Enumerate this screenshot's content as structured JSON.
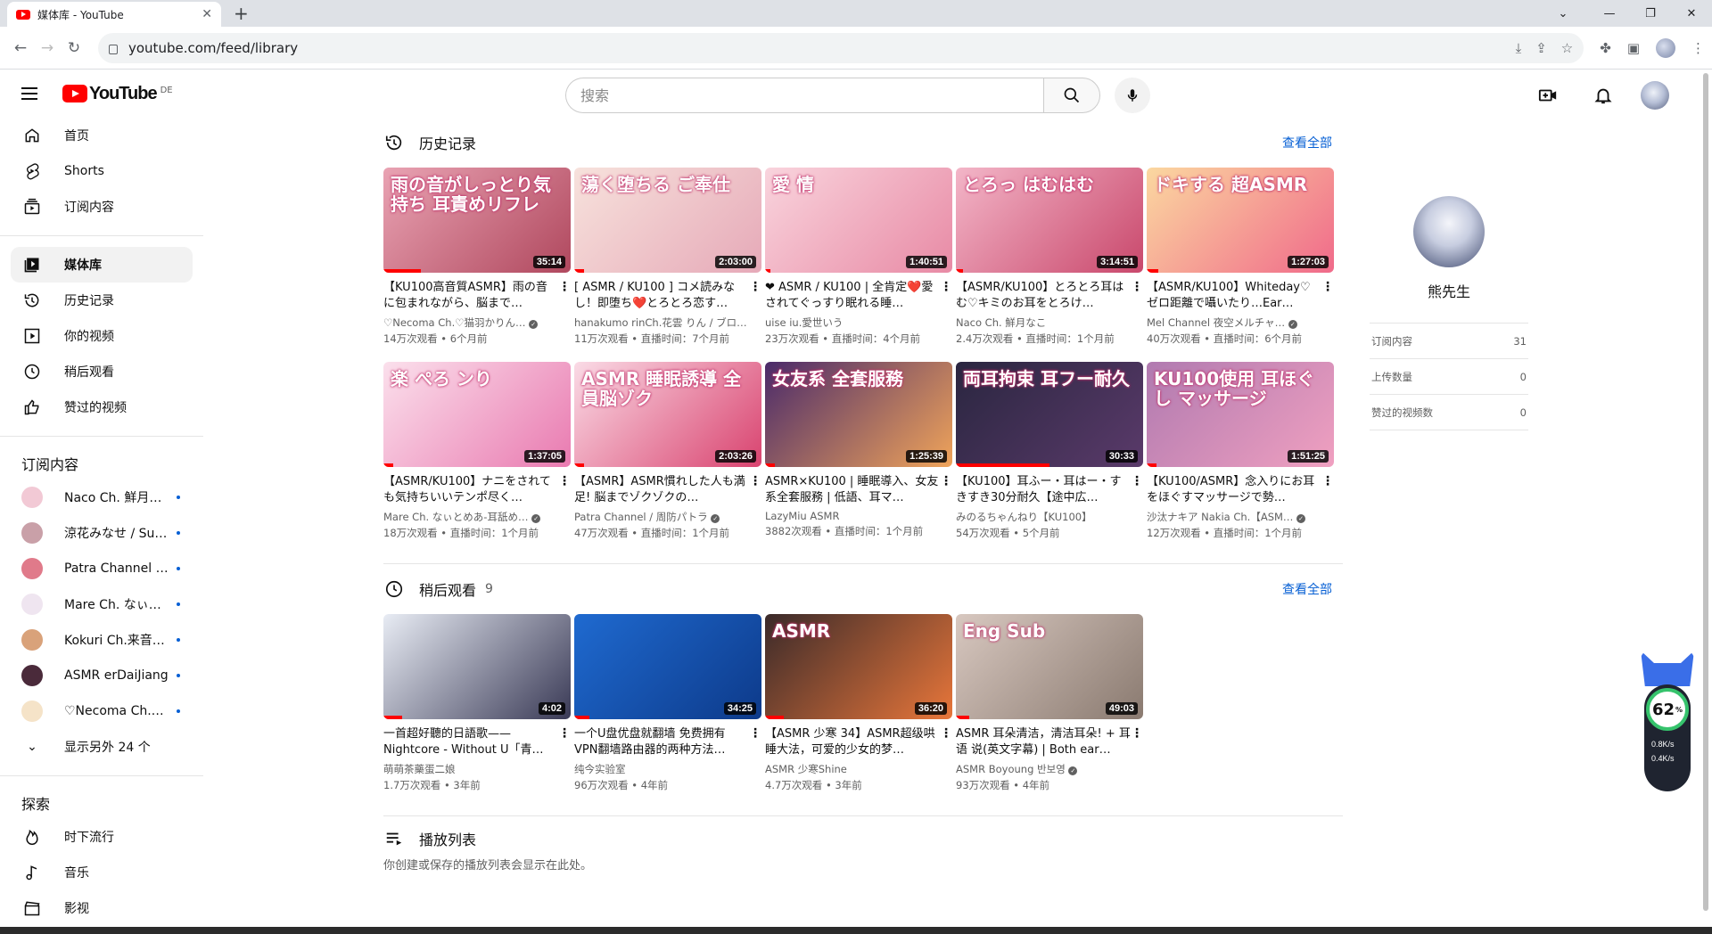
{
  "browser": {
    "tab_title": "媒体库 - YouTube",
    "tab_close": "✕",
    "new_tab": "+",
    "url": "youtube.com/feed/library"
  },
  "header": {
    "logo_text": "YouTube",
    "country_code": "DE",
    "search_placeholder": "搜索"
  },
  "sidebar": {
    "main_items": [
      {
        "label": "首页",
        "icon": "home-icon"
      },
      {
        "label": "Shorts",
        "icon": "shorts-icon"
      },
      {
        "label": "订阅内容",
        "icon": "subscriptions-icon"
      }
    ],
    "library_items": [
      {
        "label": "媒体库",
        "icon": "library-icon",
        "active": true
      },
      {
        "label": "历史记录",
        "icon": "history-icon"
      },
      {
        "label": "你的视频",
        "icon": "your-videos-icon"
      },
      {
        "label": "稍后观看",
        "icon": "watch-later-icon"
      },
      {
        "label": "赞过的视频",
        "icon": "liked-icon"
      }
    ],
    "subscriptions_heading": "订阅内容",
    "subscriptions": [
      {
        "name": "Naco Ch. 鮮月な…",
        "color": "#f2c9d5"
      },
      {
        "name": "涼花みなせ / Suz…",
        "color": "#c9a0a8"
      },
      {
        "name": "Patra Channel / …",
        "color": "#e07a8a"
      },
      {
        "name": "Mare Ch. なぃとめ…",
        "color": "#efe5f0"
      },
      {
        "name": "Kokuri Ch.来音こ…",
        "color": "#d9a27a"
      },
      {
        "name": "ASMR erDaiJiang",
        "color": "#4a2a3a"
      },
      {
        "name": "♡Necoma Ch.♡…",
        "color": "#f5e3c8"
      }
    ],
    "show_more": "显示另外 24 个",
    "explore_heading": "探索",
    "explore_items": [
      {
        "label": "时下流行",
        "icon": "trending-icon"
      },
      {
        "label": "音乐",
        "icon": "music-icon"
      },
      {
        "label": "影视",
        "icon": "movies-icon"
      }
    ]
  },
  "history": {
    "title": "历史记录",
    "see_all": "查看全部",
    "videos": [
      {
        "thumb": "雨の音がしっとり気持ち 耳責めリフレ",
        "title": "【KU100高音質ASMR】雨の音に包まれながら、脳まで…",
        "channel": "♡Necoma Ch.♡猫羽かりん…",
        "verified": true,
        "meta": "14万次观看 • 6个月前",
        "duration": "35:14",
        "progress": 0.2,
        "c1": "#e9a3b3",
        "c2": "#b0485e"
      },
      {
        "title": "[ ASMR / KU100 ] コメ読みなし！即堕ち❤️とろとろ恋す…",
        "thumb": "蕩く堕ちる ご奉仕",
        "channel": "hanakumo rinCh.花雲 りん / ブロ…",
        "verified": false,
        "meta": "11万次观看 • 直播时间：7个月前",
        "duration": "2:03:00",
        "progress": 0.05,
        "c1": "#f7e2dc",
        "c2": "#e6a9b8"
      },
      {
        "title": "❤ ASMR / KU100 | 全肯定❤️愛されてぐっすり眠れる睡…",
        "thumb": "愛 情",
        "channel": "uise iu.愛世いう",
        "verified": false,
        "meta": "23万次观看 • 直播时间：4个月前",
        "duration": "1:40:51",
        "progress": 0.03,
        "c1": "#f9d4dd",
        "c2": "#e88aa5"
      },
      {
        "title": "【ASMR/KU100】とろとろ耳はむ♡キミのお耳をとろけ…",
        "thumb": "とろっ はむはむ",
        "channel": "Naco Ch. 鮮月なこ",
        "verified": false,
        "meta": "2.4万次观看 • 直播时间：1个月前",
        "duration": "3:14:51",
        "progress": 0.04,
        "c1": "#f3b6c8",
        "c2": "#c9486c"
      },
      {
        "title": "【ASMR/KU100】Whiteday♡ゼロ距離で囁いたり…Ear…",
        "thumb": "ドキする 超ASMR",
        "channel": "Mel Channel 夜空メルチャ…",
        "verified": true,
        "meta": "40万次观看 • 直播时间：6个月前",
        "duration": "1:27:03",
        "progress": 0.06,
        "c1": "#fbd8a0",
        "c2": "#f06a8a"
      },
      {
        "title": "【ASMR/KU100】ナニをされても気持ちいいテンポ尽く…",
        "thumb": "楽 ぺろ ンり",
        "channel": "Mare Ch. なぃとめあ-耳舐め…",
        "verified": true,
        "meta": "18万次观看 • 直播时间：1个月前",
        "duration": "1:37:05",
        "progress": 0.05,
        "c1": "#fbe0ec",
        "c2": "#e97ab0"
      },
      {
        "title": "【ASMR】ASMR慣れした人も満足! 脳までゾクゾクの…",
        "thumb": "ASMR 睡眠誘導 全員脳ゾク",
        "channel": "Patra Channel / 周防パトラ",
        "verified": true,
        "meta": "47万次观看 • 直播时间：1个月前",
        "duration": "2:03:26",
        "progress": 0.05,
        "c1": "#fadbe6",
        "c2": "#d9436f"
      },
      {
        "title": "ASMR×KU100 | 睡眠導入、女友系全套服務 | 低語、耳マ…",
        "thumb": "女友系 全套服務",
        "channel": "LazyMiu ASMR",
        "verified": false,
        "meta": "3882次观看 • 直播时间：1个月前",
        "duration": "1:25:39",
        "progress": 0.05,
        "c1": "#4a2a6a",
        "c2": "#f0a45a"
      },
      {
        "title": "【KU100】耳ふー・耳はー・すきすき30分耐久【途中広…",
        "thumb": "両耳拘束 耳フー耐久",
        "channel": "みのるちゃんねり【KU100】",
        "verified": false,
        "meta": "54万次观看 • 5个月前",
        "duration": "30:33",
        "progress": 0.5,
        "c1": "#2a2640",
        "c2": "#5a3a6a"
      },
      {
        "title": "【KU100/ASMR】念入りにお耳をほぐすマッサージで勢…",
        "thumb": "KU100使用 耳ほぐし マッサージ",
        "channel": "沙汰ナキア Nakia Ch.【ASM…",
        "verified": true,
        "meta": "12万次观看 • 直播时间：1个月前",
        "duration": "1:51:25",
        "progress": 0.05,
        "c1": "#b07ab0",
        "c2": "#f0a0c0"
      }
    ]
  },
  "watch_later": {
    "title": "稍后观看",
    "count": "9",
    "see_all": "查看全部",
    "videos": [
      {
        "title": "一首超好聽的日語歌——Nightcore - Without U「青…",
        "thumb": "",
        "channel": "萌萌茶藥蛋二娘",
        "verified": false,
        "meta": "1.7万次观看 • 3年前",
        "duration": "4:02",
        "progress": 0.1,
        "c1": "#e8ecf4",
        "c2": "#3a3a56"
      },
      {
        "title": "一个U盘优盘就翻墙 免费拥有VPN翻墙路由器的两种方法…",
        "thumb": "",
        "channel": "纯今实验室",
        "verified": false,
        "meta": "96万次观看 • 4年前",
        "duration": "34:25",
        "progress": 0.08,
        "c1": "#1f6ad0",
        "c2": "#0d3a8a"
      },
      {
        "title": "【ASMR 少寒 34】ASMR超级哄睡大法，可爱的少女的梦…",
        "thumb": "ASMR",
        "channel": "ASMR 少寒Shine",
        "verified": false,
        "meta": "4.7万次观看 • 3年前",
        "duration": "36:20",
        "progress": 0.1,
        "c1": "#3a2a2a",
        "c2": "#e8763a"
      },
      {
        "title": "ASMR 耳朵清洁，清洁耳朵! + 耳语 说(英文字幕) | Both ear…",
        "thumb": "Eng Sub",
        "channel": "ASMR Boyoung 반보영",
        "verified": true,
        "meta": "93万次观看 • 4年前",
        "duration": "49:03",
        "progress": 0.07,
        "c1": "#d8c8c0",
        "c2": "#8a7a70"
      }
    ]
  },
  "playlists": {
    "title": "播放列表",
    "empty_text": "你创建或保存的播放列表会显示在此处。"
  },
  "profile": {
    "name": "熊先生",
    "stats": [
      {
        "label": "订阅内容",
        "value": "31"
      },
      {
        "label": "上传数量",
        "value": "0"
      },
      {
        "label": "赞过的视频数",
        "value": "0"
      }
    ]
  },
  "widget": {
    "percent": "62",
    "percent_sign": "%",
    "up_speed": "0.8K/s",
    "down_speed": "0.4K/s"
  }
}
